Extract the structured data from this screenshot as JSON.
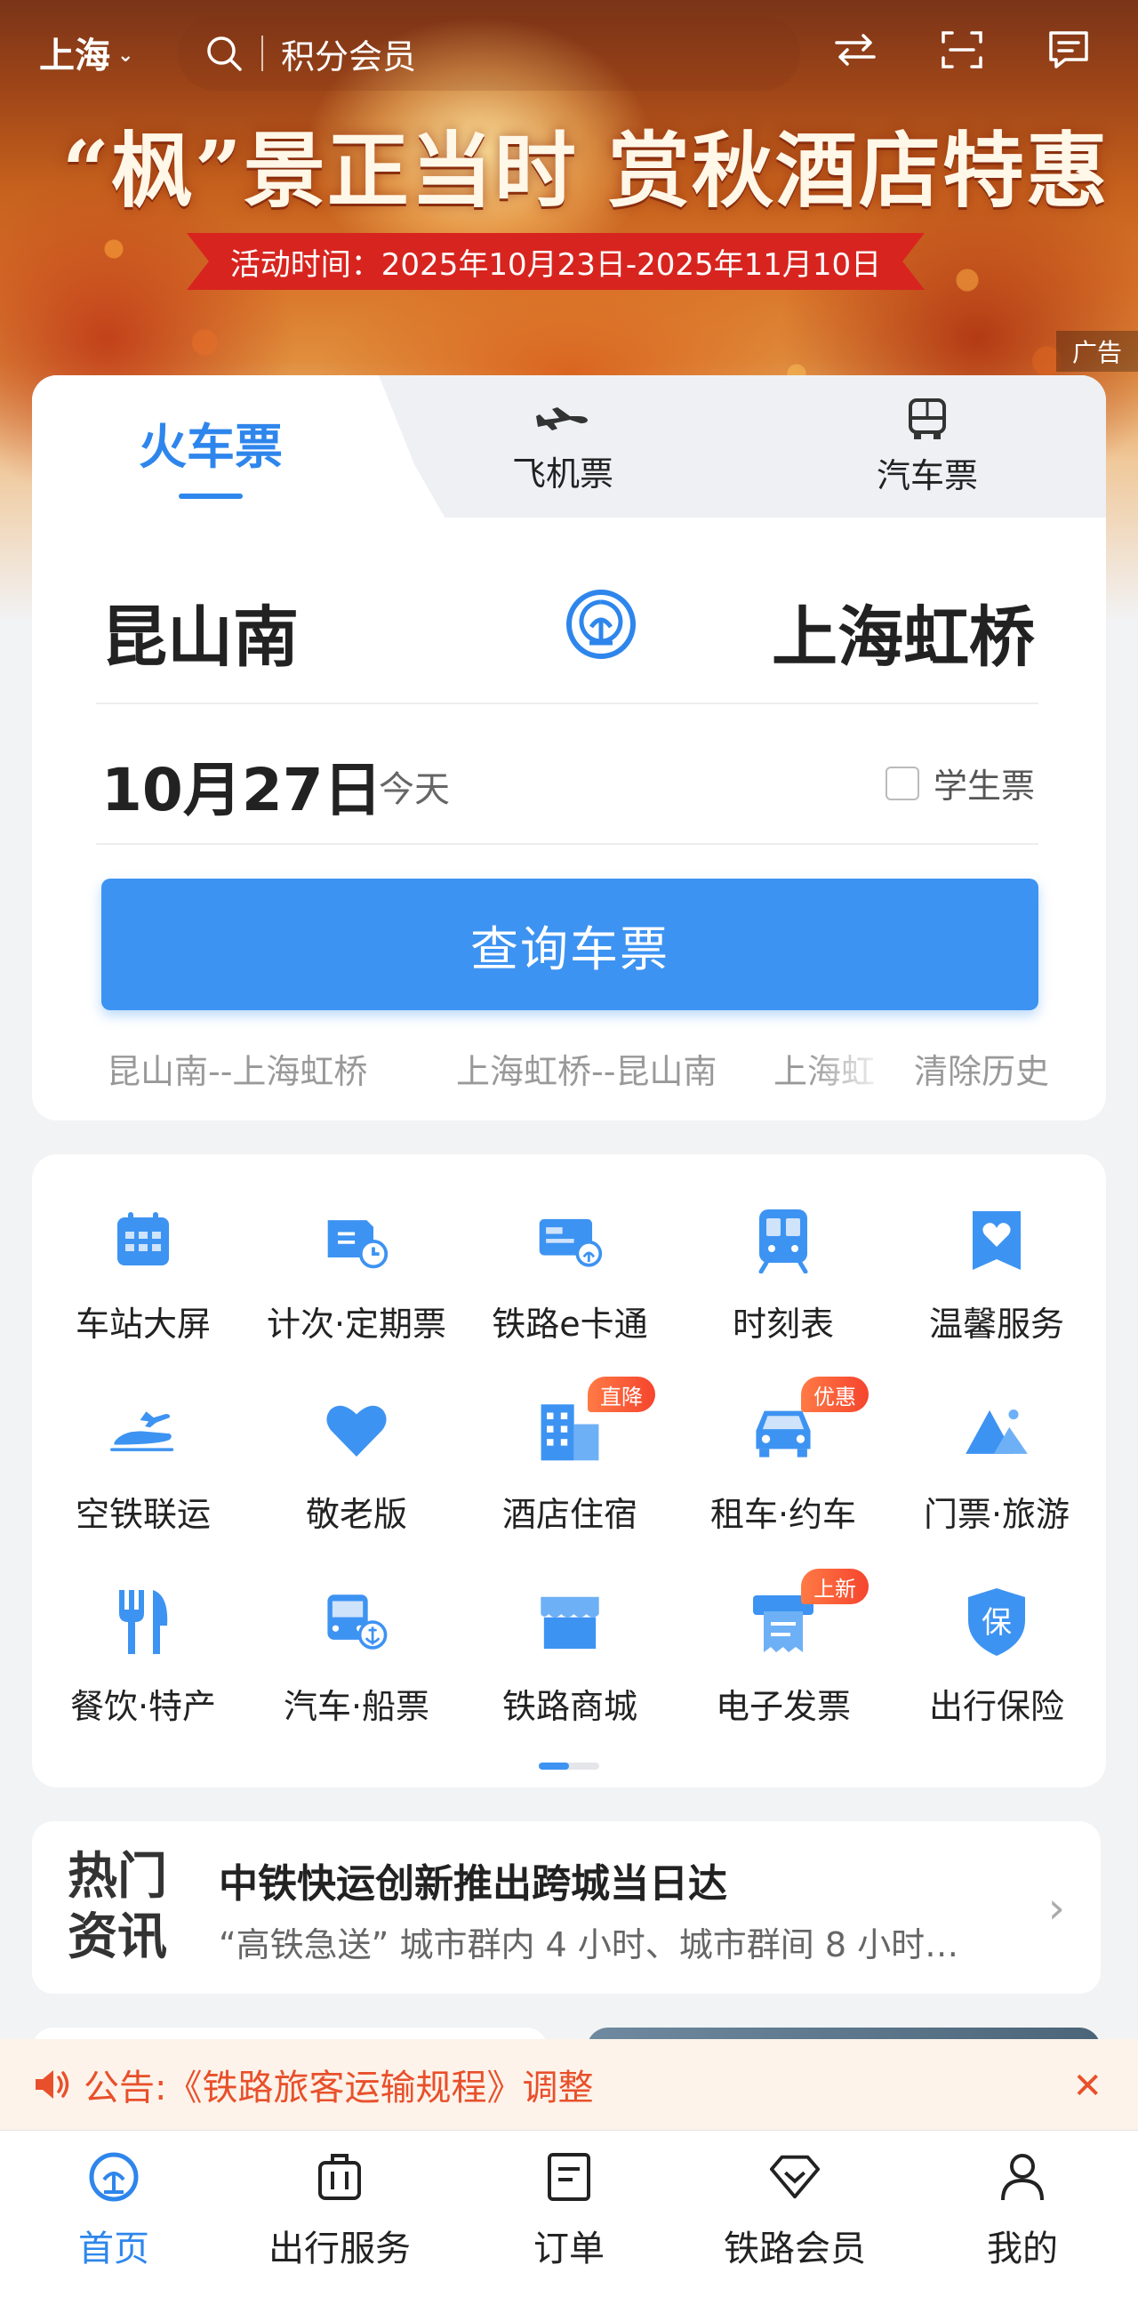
{
  "header": {
    "city": "上海",
    "search_placeholder": "积分会员"
  },
  "banner": {
    "headline": "“枫”景正当时  赏秋酒店特惠",
    "event_time": "活动时间：2025年10月23日-2025年11月10日",
    "ad_tag": "广告"
  },
  "tabs": [
    {
      "label": "火车票",
      "active": true
    },
    {
      "label": "飞机票",
      "active": false
    },
    {
      "label": "汽车票",
      "active": false
    }
  ],
  "booking": {
    "from_station": "昆山南",
    "to_station": "上海虹桥",
    "date": "10月27日",
    "date_hint": "今天",
    "student_ticket_label": "学生票",
    "student_ticket_checked": false,
    "query_button": "查询车票",
    "history": [
      "昆山南--上海虹桥",
      "上海虹桥--昆山南",
      "上海虹",
      "清除历史"
    ]
  },
  "services": [
    {
      "label": "车站大屏",
      "icon": "calendar-grid-icon"
    },
    {
      "label": "计次·定期票",
      "icon": "ticket-clock-icon"
    },
    {
      "label": "铁路e卡通",
      "icon": "rail-card-icon"
    },
    {
      "label": "时刻表",
      "icon": "train-front-icon"
    },
    {
      "label": "温馨服务",
      "icon": "heart-tag-icon"
    },
    {
      "label": "空铁联运",
      "icon": "air-rail-icon"
    },
    {
      "label": "敬老版",
      "icon": "heart-icon"
    },
    {
      "label": "酒店住宿",
      "icon": "hotel-icon",
      "badge": "直降"
    },
    {
      "label": "租车·约车",
      "icon": "car-icon",
      "badge": "优惠"
    },
    {
      "label": "门票·旅游",
      "icon": "mountain-icon"
    },
    {
      "label": "餐饮·特产",
      "icon": "fork-knife-icon"
    },
    {
      "label": "汽车·船票",
      "icon": "bus-anchor-icon"
    },
    {
      "label": "铁路商城",
      "icon": "shop-icon"
    },
    {
      "label": "电子发票",
      "icon": "invoice-printer-icon",
      "badge": "上新"
    },
    {
      "label": "出行保险",
      "icon": "insurance-shield-icon"
    }
  ],
  "news": {
    "tag_line1": "热门",
    "tag_line2": "资讯",
    "title": "中铁快运创新推出跨城当日达",
    "subtitle": "“高铁急送” 城市群内 4 小时、城市群间 8 小时…"
  },
  "notice": {
    "text": "公告:《铁路旅客运输规程》调整"
  },
  "bottom_nav": [
    {
      "label": "首页",
      "active": true
    },
    {
      "label": "出行服务",
      "active": false
    },
    {
      "label": "订单",
      "active": false
    },
    {
      "label": "铁路会员",
      "active": false
    },
    {
      "label": "我的",
      "active": false
    }
  ],
  "colors": {
    "accent": "#2e86ec",
    "button": "#3d93f2",
    "notice": "#e8502b"
  }
}
